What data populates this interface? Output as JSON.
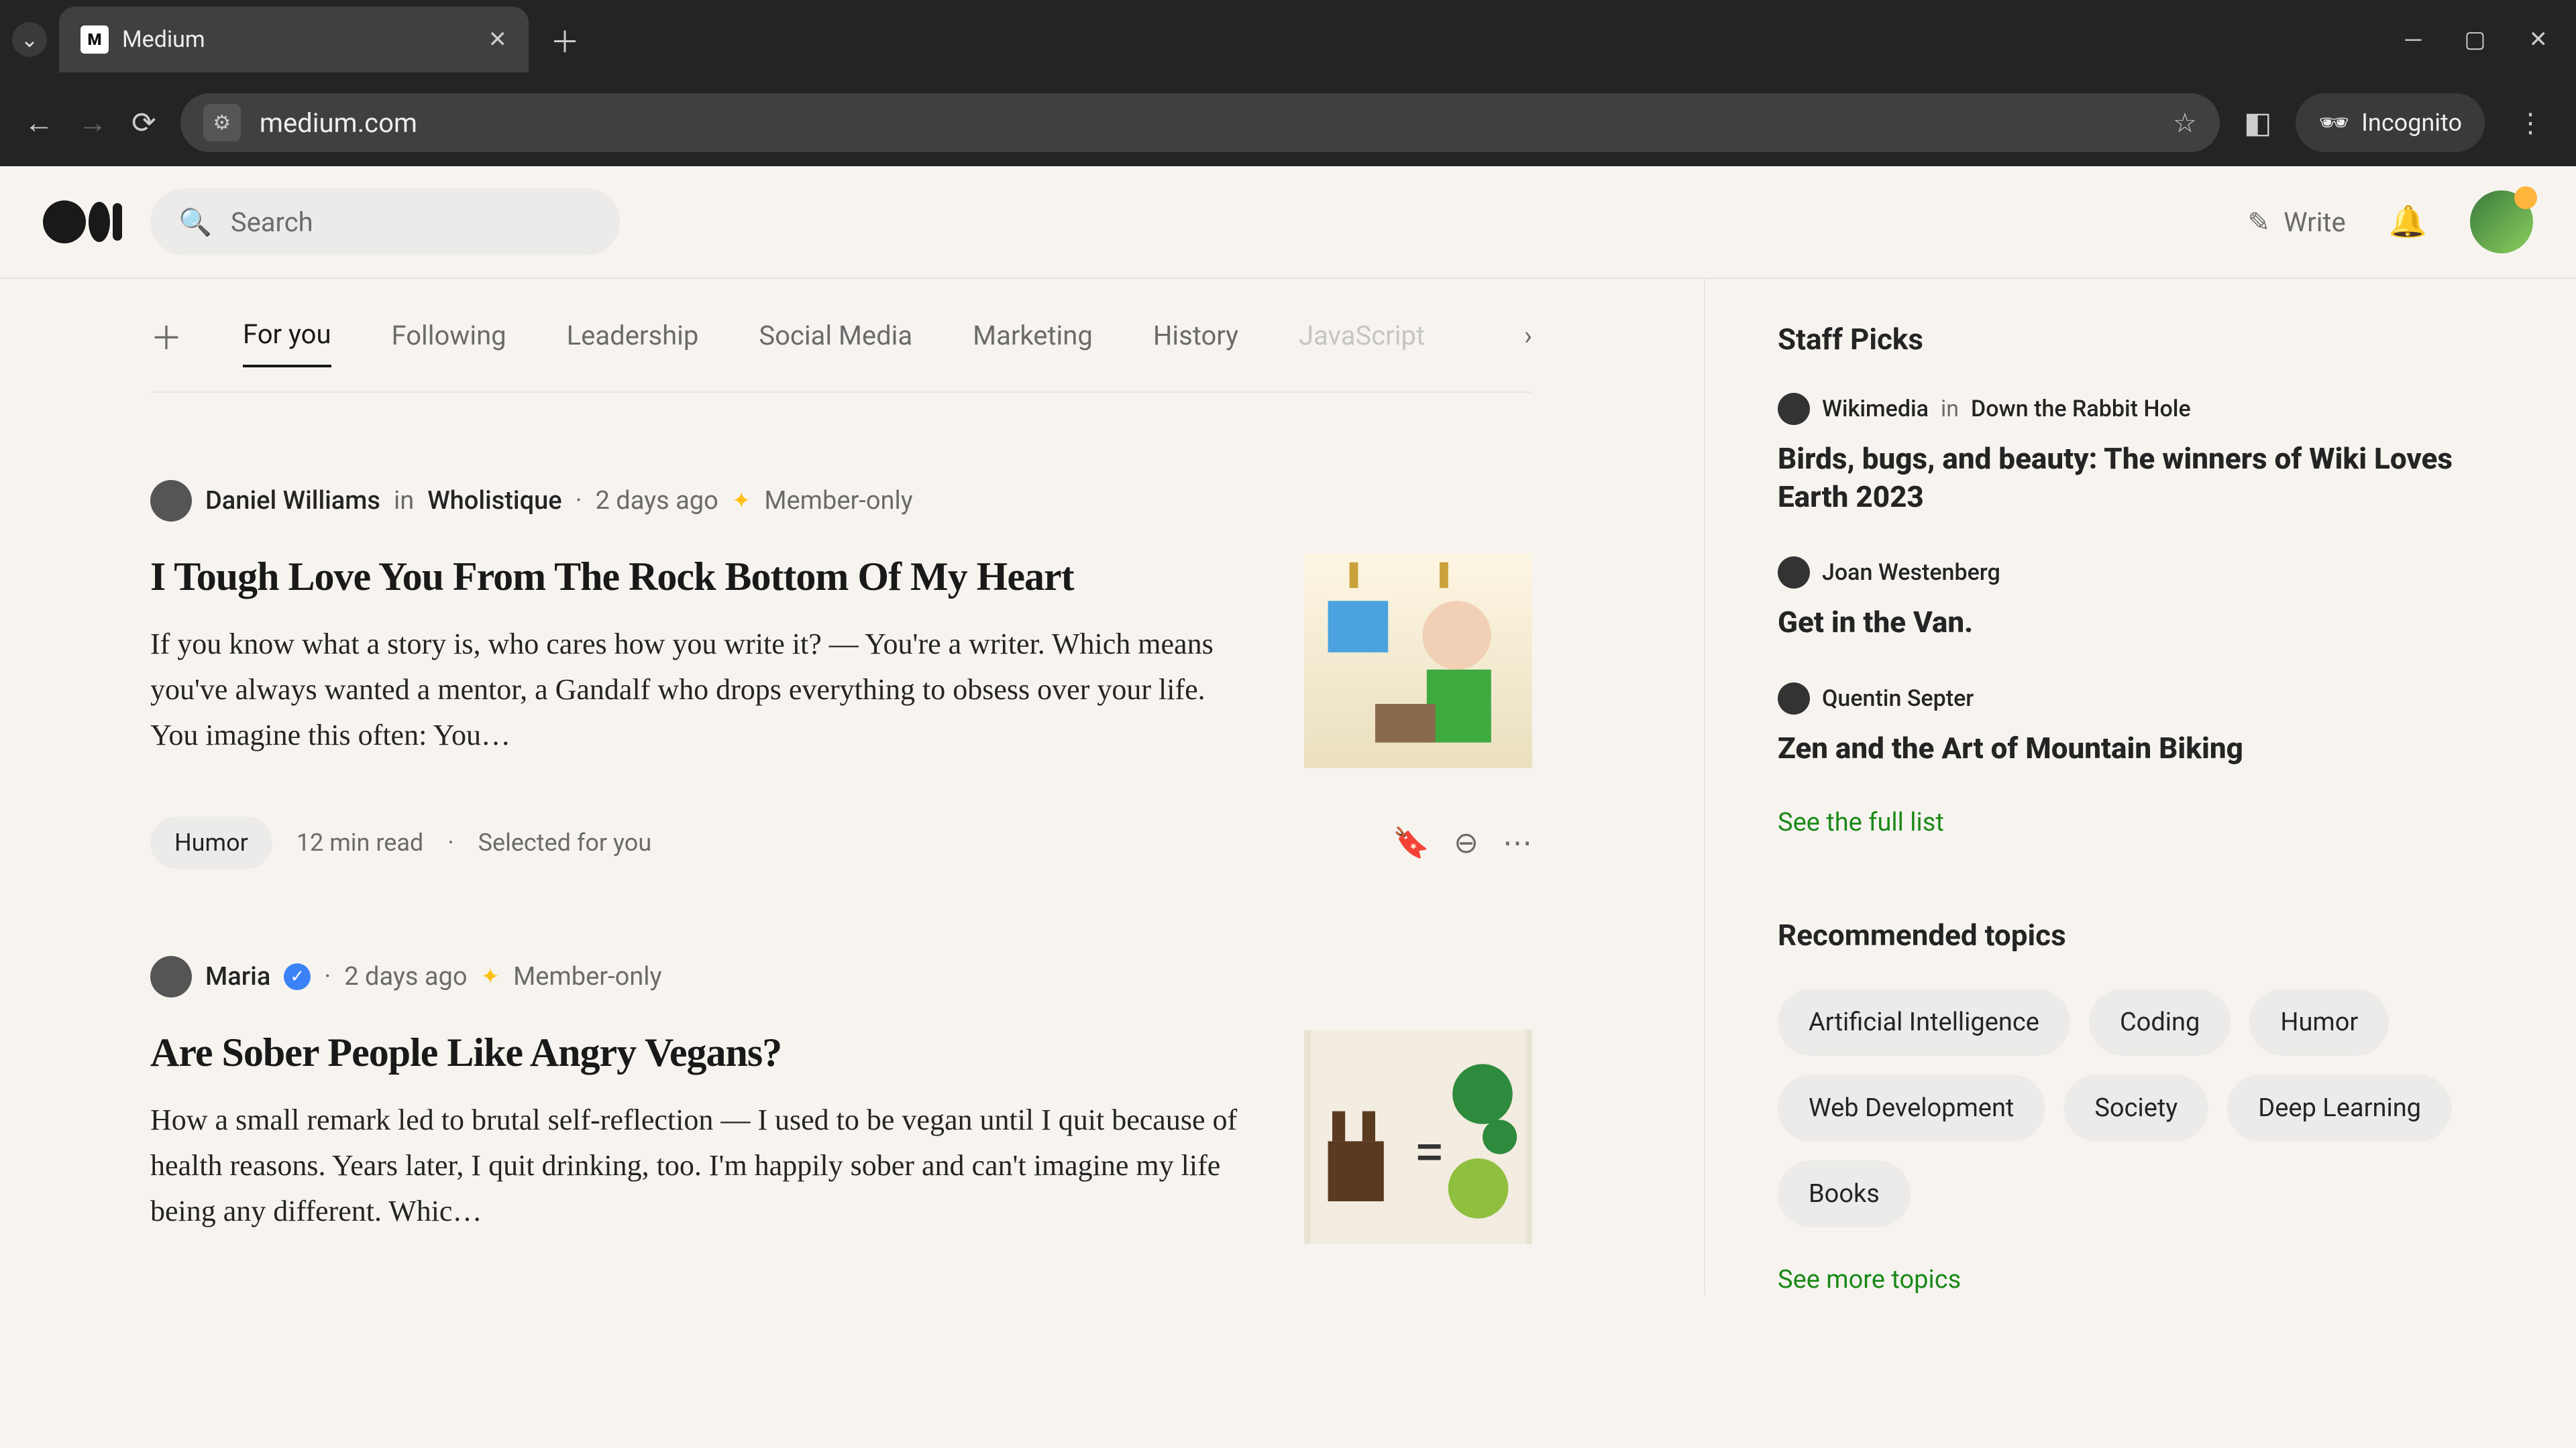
{
  "browser": {
    "tab_title": "Medium",
    "url": "medium.com",
    "incognito_label": "Incognito"
  },
  "header": {
    "search_placeholder": "Search",
    "write_label": "Write"
  },
  "tabs": [
    "For you",
    "Following",
    "Leadership",
    "Social Media",
    "Marketing",
    "History",
    "JavaScript"
  ],
  "articles": [
    {
      "author": "Daniel Williams",
      "in_word": "in",
      "publication": "Wholistique",
      "date": "2 days ago",
      "member_label": "Member-only",
      "title": "I Tough Love You From The Rock Bottom Of My Heart",
      "desc": "If you know what a story is, who cares how you write it? — You're a writer. Which means you've always wanted a mentor, a Gandalf who drops everything to obsess over your life. You imagine this often: You…",
      "tag": "Humor",
      "read": "12 min read",
      "selected": "Selected for you"
    },
    {
      "author": "Maria",
      "verified": true,
      "date": "2 days ago",
      "member_label": "Member-only",
      "title": "Are Sober People Like Angry Vegans?",
      "desc": "How a small remark led to brutal self-reflection — I used to be vegan until I quit because of health reasons. Years later, I quit drinking, too. I'm happily sober and can't imagine my life being any different. Whic…"
    }
  ],
  "staff_picks": {
    "heading": "Staff Picks",
    "items": [
      {
        "author": "Wikimedia",
        "in": "in",
        "pub": "Down the Rabbit Hole",
        "title": "Birds, bugs, and beauty: The winners of Wiki Loves Earth 2023"
      },
      {
        "author": "Joan Westenberg",
        "title": "Get in the Van."
      },
      {
        "author": "Quentin Septer",
        "title": "Zen and the Art of Mountain Biking"
      }
    ],
    "see_all": "See the full list"
  },
  "topics": {
    "heading": "Recommended topics",
    "items": [
      "Artificial Intelligence",
      "Coding",
      "Humor",
      "Web Development",
      "Society",
      "Deep Learning",
      "Books"
    ],
    "see_more": "See more topics"
  }
}
